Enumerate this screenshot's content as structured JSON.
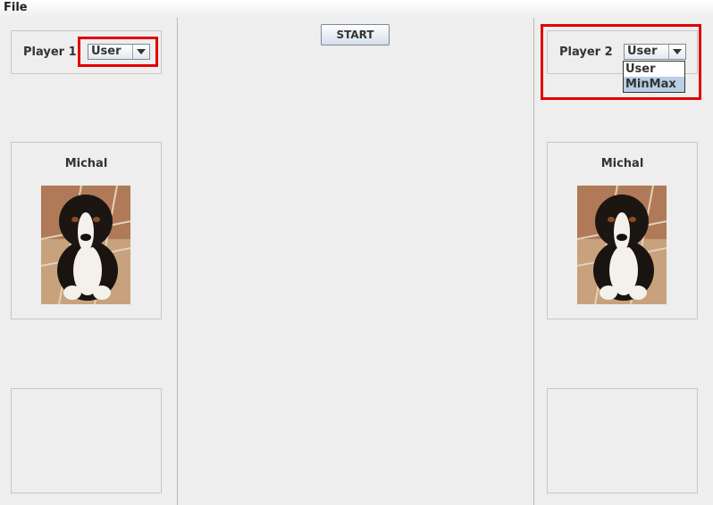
{
  "menu": {
    "file": "File"
  },
  "toolbar": {
    "start": "START"
  },
  "player1": {
    "label": "Player 1",
    "mode": "User",
    "name": "Michal",
    "photo_icon": "dog-photo"
  },
  "player2": {
    "label": "Player 2",
    "mode": "User",
    "name": "Michal",
    "photo_icon": "dog-photo",
    "dropdown": {
      "options": [
        "User",
        "MinMax"
      ],
      "highlighted": "MinMax"
    }
  },
  "colors": {
    "highlight": "#e00000",
    "selection": "#b8cfe5",
    "background": "#eeeeee"
  }
}
